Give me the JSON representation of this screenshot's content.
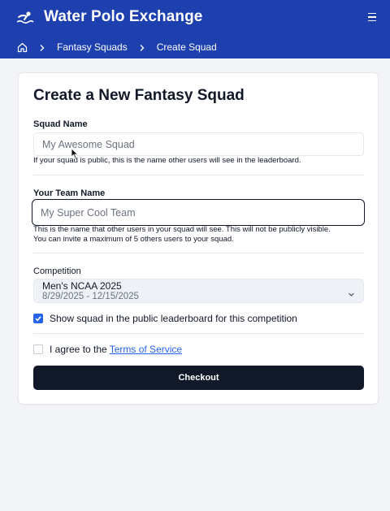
{
  "header": {
    "title": "Water Polo Exchange",
    "logo_icon": "swimmer-logo-icon",
    "menu_icon": "hamburger-menu-icon",
    "color": "#1e40af"
  },
  "breadcrumb": {
    "home_icon": "home-icon",
    "items": [
      "Fantasy Squads",
      "Create Squad"
    ]
  },
  "form": {
    "title": "Create a New Fantasy Squad",
    "squad_name": {
      "label": "Squad Name",
      "placeholder": "My Awesome Squad",
      "value": "",
      "help": "If your squad is public, this is the name other users will see in the leaderboard."
    },
    "team_name": {
      "label": "Your Team Name",
      "placeholder": "My Super Cool Team",
      "value": "",
      "help_1": "This is the name that other users in your squad will see. This will not be publicly visible.",
      "help_2": "You can invite a maximum of 5 others users to your squad."
    },
    "competition": {
      "label": "Competition",
      "selected_name": "Men's NCAA 2025",
      "selected_dates": "8/29/2025 - 12/15/2025"
    },
    "public_checkbox": {
      "label": "Show squad in the public leaderboard for this competition",
      "checked": true
    },
    "terms_checkbox": {
      "prefix": "I agree to the",
      "link": "Terms of Service",
      "checked": false
    },
    "checkout_label": "Checkout"
  },
  "colors": {
    "accent": "#2563eb",
    "button": "#111827"
  }
}
